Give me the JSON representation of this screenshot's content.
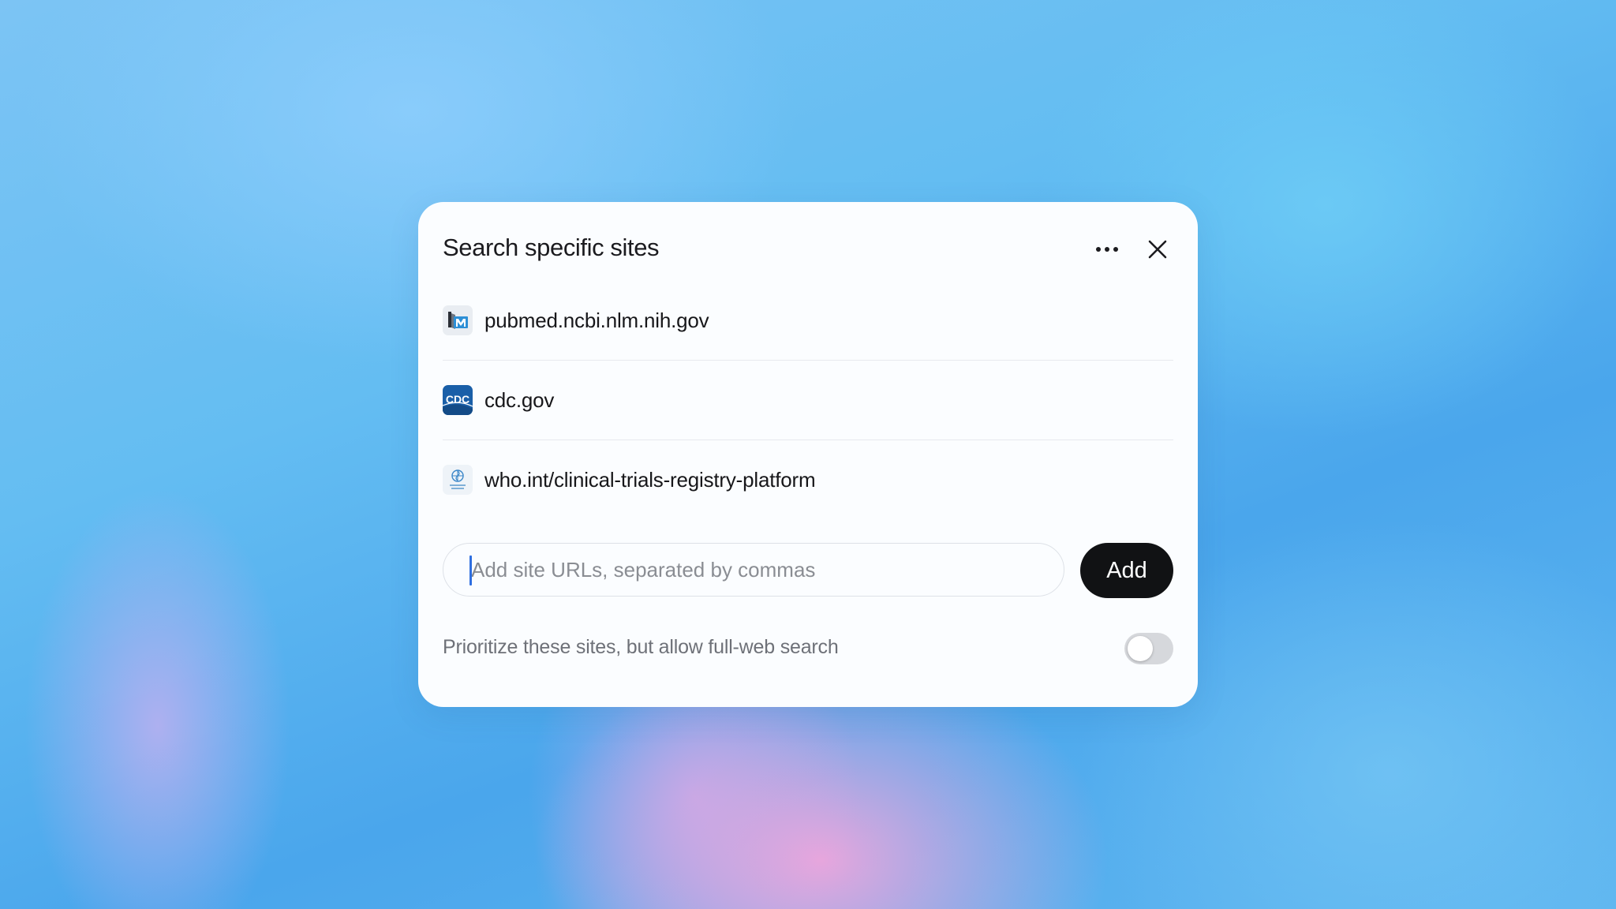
{
  "dialog": {
    "title": "Search specific sites",
    "more_icon": "more-horizontal-icon",
    "close_icon": "close-icon"
  },
  "sites": [
    {
      "label": "pubmed.ncbi.nlm.nih.gov",
      "icon": "pubmed-favicon"
    },
    {
      "label": "cdc.gov",
      "icon": "cdc-favicon",
      "icon_text": "CDC"
    },
    {
      "label": "who.int/clinical-trials-registry-platform",
      "icon": "who-favicon"
    }
  ],
  "add_form": {
    "value": "",
    "placeholder": "Add site URLs, separated by commas",
    "button_label": "Add"
  },
  "prioritize": {
    "label": "Prioritize these sites, but allow full-web search",
    "enabled": false
  },
  "colors": {
    "accent_caret": "#2f6fe0",
    "button_bg": "#111214",
    "cdc_blue": "#1a5fa8"
  }
}
